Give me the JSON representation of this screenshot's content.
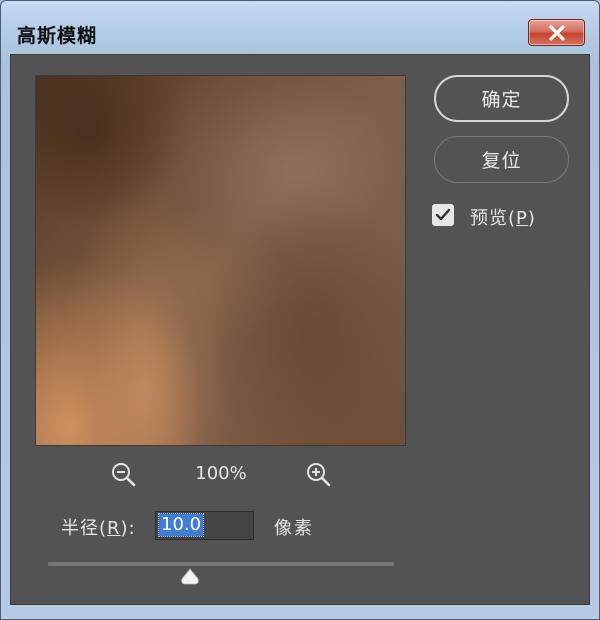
{
  "window": {
    "title": "高斯模糊",
    "close_icon": "close-icon"
  },
  "preview": {
    "zoom_level": "100%",
    "zoom_out_icon": "zoom-out-icon",
    "zoom_in_icon": "zoom-in-icon"
  },
  "radius": {
    "label_prefix": "半径(",
    "label_mnemonic": "R",
    "label_suffix": "):",
    "value": "10.0",
    "unit": "像素",
    "slider_level": 0.41
  },
  "buttons": {
    "ok_label": "确定",
    "reset_label": "复位"
  },
  "preview_toggle": {
    "checked": true,
    "label_prefix": "预览(",
    "label_mnemonic": "P",
    "label_suffix": ")"
  },
  "colors": {
    "dialog_bg": "#535353",
    "selection": "#3f7cd8",
    "close_button": "#c44530"
  }
}
